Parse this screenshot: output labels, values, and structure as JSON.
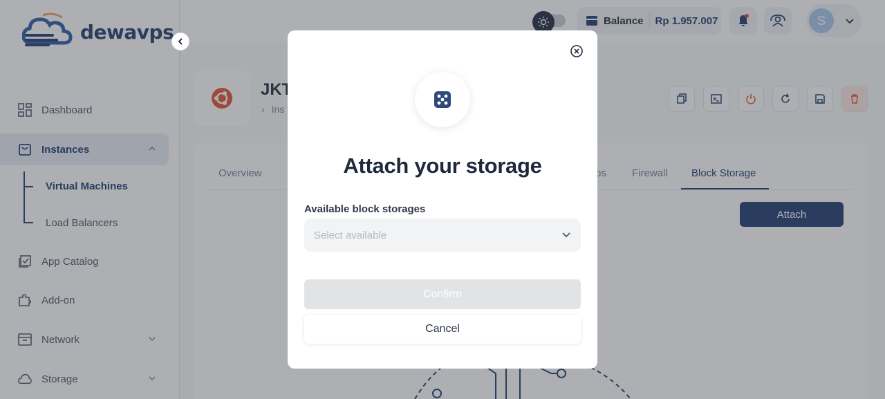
{
  "brand": {
    "name": "dewavps"
  },
  "colors": {
    "primary": "#1e3b6e",
    "danger": "#e0532f",
    "notification": "#e53e3e"
  },
  "sidebar": {
    "items": [
      {
        "label": "Dashboard",
        "icon": "grid-icon"
      },
      {
        "label": "Instances",
        "icon": "bag-icon",
        "active": true,
        "expanded": true
      },
      {
        "label": "App Catalog",
        "icon": "checklist-icon"
      },
      {
        "label": "Add-on",
        "icon": "puzzle-icon"
      },
      {
        "label": "Network",
        "icon": "archive-icon"
      },
      {
        "label": "Storage",
        "icon": "cloud-icon"
      }
    ],
    "subitems": [
      {
        "label": "Virtual Machines",
        "active": true
      },
      {
        "label": "Load Balancers"
      }
    ]
  },
  "header": {
    "balance_label": "Balance",
    "balance_value": "Rp 1.957.007",
    "avatar_initial": "S"
  },
  "instance": {
    "title": "JKT",
    "breadcrumb": "Ins"
  },
  "tabs": [
    {
      "label": "Overview"
    },
    {
      "label": "ps"
    },
    {
      "label": "Firewall"
    },
    {
      "label": "Block Storage",
      "active": true
    }
  ],
  "attach_button": "Attach",
  "modal": {
    "title": "Attach your storage",
    "field_label": "Available block storages",
    "select_placeholder": "Select available",
    "confirm_label": "Confirm",
    "cancel_label": "Cancel"
  }
}
